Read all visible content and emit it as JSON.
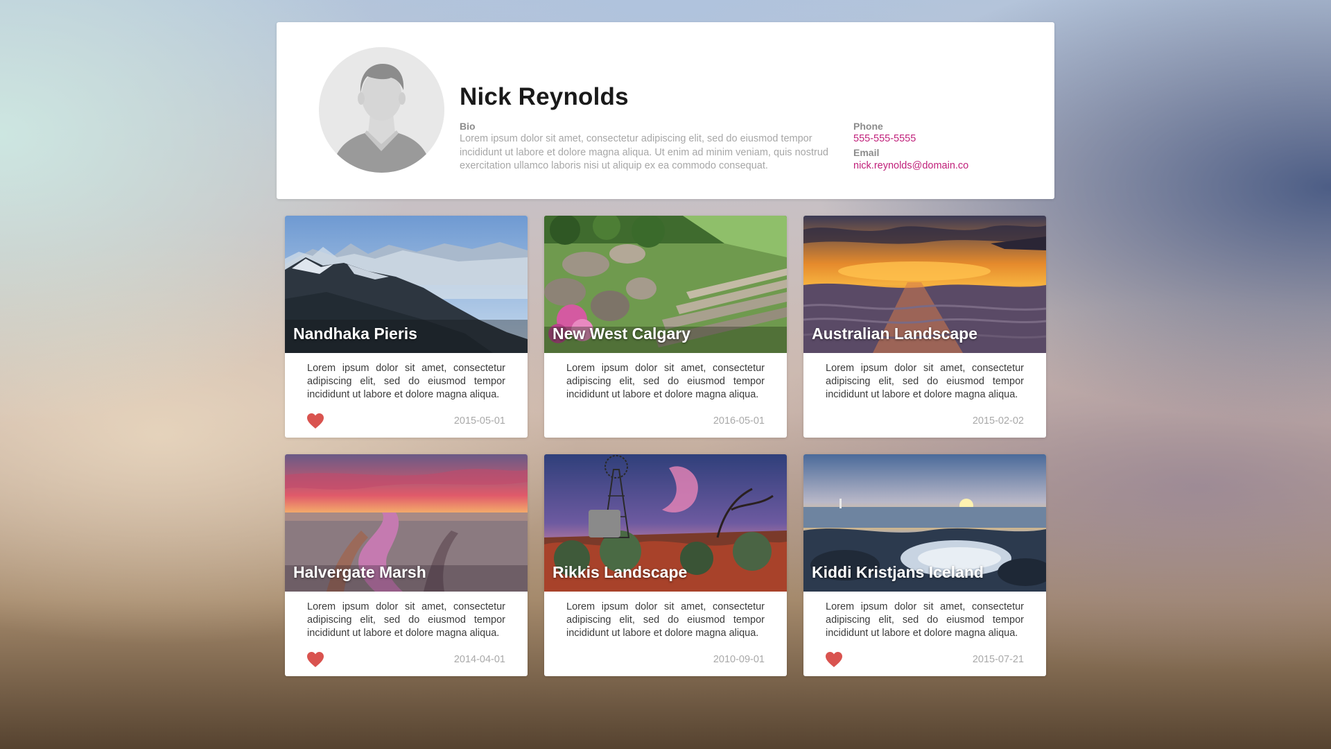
{
  "profile": {
    "name": "Nick Reynolds",
    "bio_label": "Bio",
    "bio_text": "Lorem ipsum dolor sit amet, consectetur adipiscing elit, sed do eiusmod tempor incididunt ut labore et dolore magna aliqua. Ut enim ad minim veniam, quis nostrud exercitation ullamco laboris nisi ut aliquip ex ea commodo consequat.",
    "phone_label": "Phone",
    "phone": "555-555-5555",
    "email_label": "Email",
    "email": "nick.reynolds@domain.co"
  },
  "colors": {
    "accent": "#c0207a",
    "heart": "#d9534f"
  },
  "cards": [
    {
      "title": "Nandhaka Pieris",
      "text": "Lorem ipsum dolor sit amet, consectetur adipiscing elit, sed do eiusmod tempor incididunt ut labore et dolore magna aliqua.",
      "date": "2015-05-01",
      "liked": true
    },
    {
      "title": "New West Calgary",
      "text": "Lorem ipsum dolor sit amet, consectetur adipiscing elit, sed do eiusmod tempor incididunt ut labore et dolore magna aliqua.",
      "date": "2016-05-01",
      "liked": false
    },
    {
      "title": "Australian Landscape",
      "text": "Lorem ipsum dolor sit amet, consectetur adipiscing elit, sed do eiusmod tempor incididunt ut labore et dolore magna aliqua.",
      "date": "2015-02-02",
      "liked": false
    },
    {
      "title": "Halvergate Marsh",
      "text": "Lorem ipsum dolor sit amet, consectetur adipiscing elit, sed do eiusmod tempor incididunt ut labore et dolore magna aliqua.",
      "date": "2014-04-01",
      "liked": true
    },
    {
      "title": "Rikkis Landscape",
      "text": "Lorem ipsum dolor sit amet, consectetur adipiscing elit, sed do eiusmod tempor incididunt ut labore et dolore magna aliqua.",
      "date": "2010-09-01",
      "liked": false
    },
    {
      "title": "Kiddi Kristjans Iceland",
      "text": "Lorem ipsum dolor sit amet, consectetur adipiscing elit, sed do eiusmod tempor incididunt ut labore et dolore magna aliqua.",
      "date": "2015-07-21",
      "liked": true
    }
  ]
}
